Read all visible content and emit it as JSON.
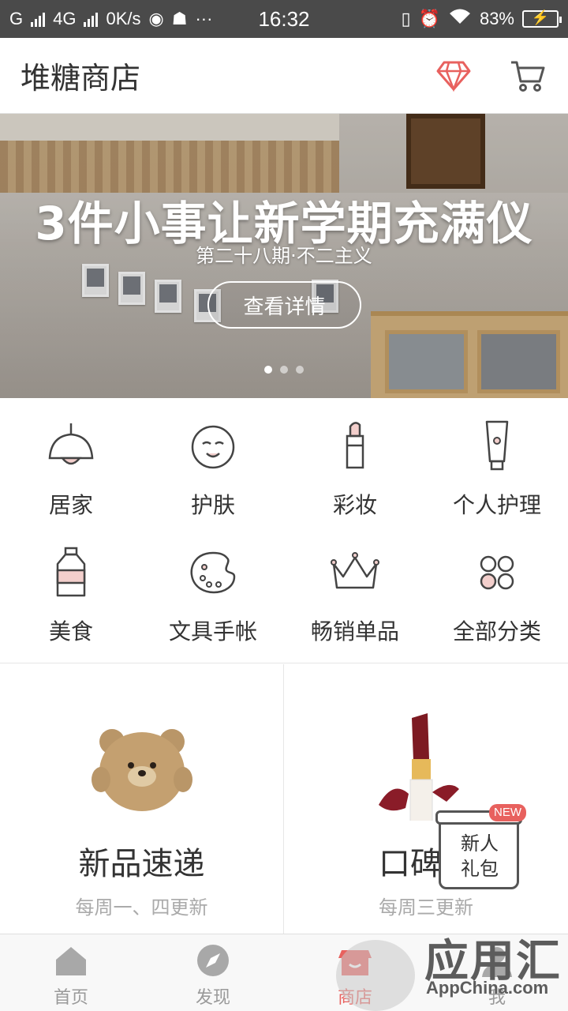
{
  "status_bar": {
    "carrier1": "G",
    "network": "4G",
    "speed": "0K/s",
    "more": "···",
    "time": "16:32",
    "battery": "83%"
  },
  "header": {
    "title": "堆糖商店",
    "icons": [
      "diamond-icon",
      "cart-icon"
    ]
  },
  "banner": {
    "title": "3件小事让新学期充满仪",
    "subtitle": "第二十八期·不二主义",
    "button": "查看详情",
    "page_count": 3,
    "active_page": 1
  },
  "categories": [
    {
      "label": "居家",
      "icon": "lamp-icon"
    },
    {
      "label": "护肤",
      "icon": "face-icon"
    },
    {
      "label": "彩妆",
      "icon": "lipstick-icon"
    },
    {
      "label": "个人护理",
      "icon": "tube-icon"
    },
    {
      "label": "美食",
      "icon": "bottle-icon"
    },
    {
      "label": "文具手帐",
      "icon": "palette-icon"
    },
    {
      "label": "畅销单品",
      "icon": "crown-icon"
    },
    {
      "label": "全部分类",
      "icon": "grid-dots-icon"
    }
  ],
  "cards": [
    {
      "title": "新品速递",
      "subtitle": "每周一、四更新",
      "image": "teddy-bear"
    },
    {
      "title": "口碑井",
      "subtitle": "每周三更新",
      "image": "lipstick"
    }
  ],
  "gift": {
    "badge": "NEW",
    "line1": "新人",
    "line2": "礼包"
  },
  "tabbar": [
    {
      "label": "首页",
      "icon": "home-icon",
      "active": false
    },
    {
      "label": "发现",
      "icon": "compass-icon",
      "active": false
    },
    {
      "label": "商店",
      "icon": "shop-icon",
      "active": true
    },
    {
      "label": "我",
      "icon": "profile-icon",
      "active": false
    }
  ],
  "watermark": {
    "text": "应用汇",
    "domain": "AppChina.com"
  },
  "colors": {
    "accent": "#e8615e",
    "statusbar": "#4a4a4a",
    "text": "#333333",
    "muted": "#aaaaaa"
  }
}
